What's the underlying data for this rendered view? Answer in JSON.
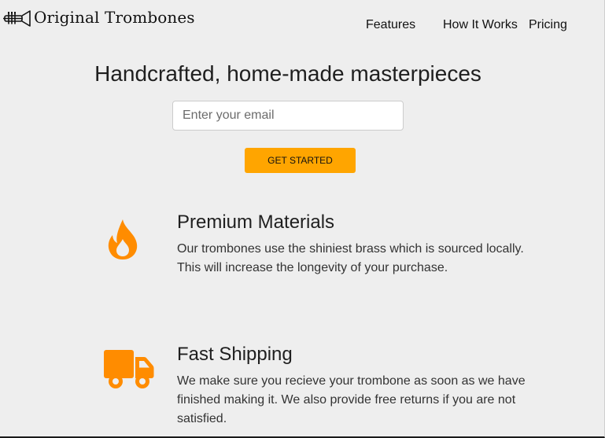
{
  "header": {
    "logo_text": "Original Trombones",
    "logo_icon": "trombone-icon",
    "nav": [
      {
        "label": "Features"
      },
      {
        "label": "How It Works"
      },
      {
        "label": "Pricing"
      }
    ]
  },
  "hero": {
    "title": "Handcrafted, home-made masterpieces",
    "email_placeholder": "Enter your email",
    "email_value": "",
    "cta_label": "GET STARTED"
  },
  "features": [
    {
      "icon": "fire-icon",
      "title": "Premium Materials",
      "description": "Our trombones use the shiniest brass which is sourced locally. This will increase the longevity of your purchase."
    },
    {
      "icon": "truck-icon",
      "title": "Fast Shipping",
      "description": "We make sure you recieve your trombone as soon as we have finished making it. We also provide free returns if you are not satisfied."
    }
  ],
  "colors": {
    "background": "#eeeeee",
    "accent": "#ffa500",
    "icon": "#ff8c00",
    "text": "#1f1f1f"
  }
}
